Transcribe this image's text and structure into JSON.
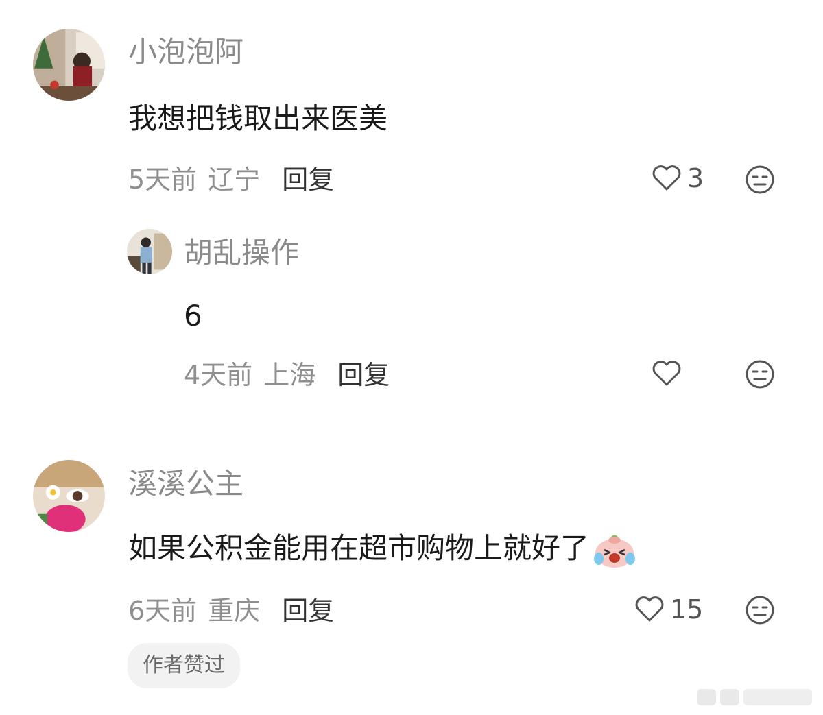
{
  "comments": [
    {
      "username": "小泡泡阿",
      "text": "我想把钱取出来医美",
      "time": "5天前",
      "location": "辽宁",
      "reply_label": "回复",
      "likes": "3"
    },
    {
      "username": "胡乱操作",
      "text": "6",
      "time": "4天前",
      "location": "上海",
      "reply_label": "回复",
      "likes": ""
    },
    {
      "username": "溪溪公主",
      "text": "如果公积金能用在超市购物上就好了",
      "time": "6天前",
      "location": "重庆",
      "reply_label": "回复",
      "likes": "15",
      "badge": "作者赞过"
    }
  ],
  "icons": {
    "like": "heart-outline-icon",
    "dislike": "neutral-face-icon",
    "emoji": "crying-laughing-sticker"
  },
  "colors": {
    "username": "#8a8a8a",
    "meta": "#8f8f8f",
    "reply": "#333333",
    "badge_bg": "#f2f2f2"
  }
}
